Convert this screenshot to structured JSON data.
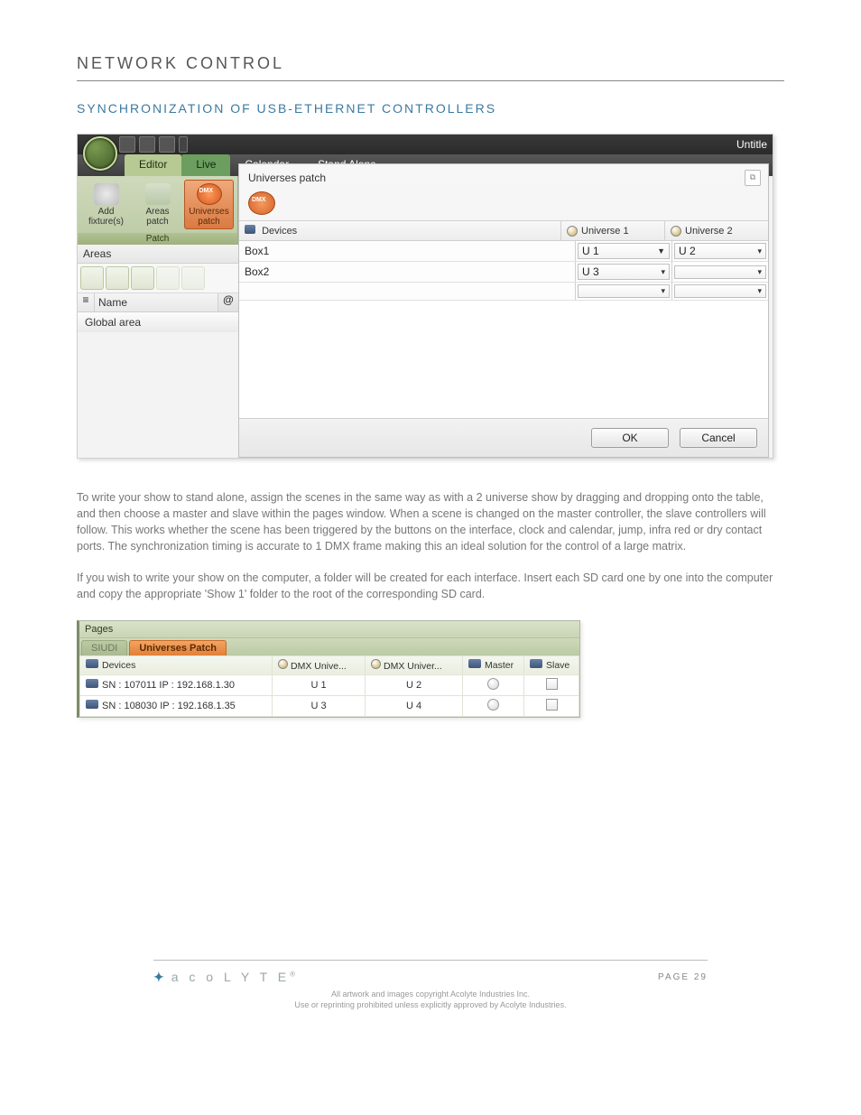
{
  "page": {
    "heading": "NETWORK CONTROL",
    "section_title": "SYNCHRONIZATION OF USB-ETHERNET CONTROLLERS"
  },
  "shot1": {
    "title_right": "Untitle",
    "tabs": {
      "editor": "Editor",
      "live": "Live",
      "calendar": "Calendar",
      "standalone": "Stand Alone"
    },
    "patch": {
      "add_fixtures": "Add\nfixture(s)",
      "areas_patch": "Areas\npatch",
      "universes_patch": "Universes\npatch",
      "group_label": "Patch"
    },
    "side": {
      "areas_hdr": "Areas",
      "name_label": "Name",
      "at_symbol": "@",
      "global_area": "Global area"
    },
    "dialog": {
      "title": "Universes patch",
      "cols": {
        "devices": "Devices",
        "u1": "Universe 1",
        "u2": "Universe 2"
      },
      "rows": [
        {
          "device": "Box1",
          "u1": "U 1",
          "u2": "U 2"
        },
        {
          "device": "Box2",
          "u1": "U 3",
          "u2": ""
        }
      ],
      "empty_row": {
        "u1": "",
        "u2": ""
      },
      "ok": "OK",
      "cancel": "Cancel"
    }
  },
  "para1": "To write your show to stand alone, assign the scenes in the same way as with a 2 universe show by dragging and dropping onto the table, and then choose a master and slave within the pages window.  When a scene is changed on the master controller, the slave controllers will follow. This works whether the scene has been triggered by the buttons on the interface, clock and calendar, jump, infra red or dry contact ports. The synchronization timing is accurate to 1 DMX frame making this an ideal solution for the control of a large matrix.",
  "para2": "If you wish to write your show on the computer, a folder will be created for each interface. Insert each SD card one by one into the computer and copy the appropriate 'Show 1' folder to the root of the corresponding SD card.",
  "shot2": {
    "pages_label": "Pages",
    "tabs": {
      "siudi": "SIUDI",
      "universes": "Universes Patch"
    },
    "cols": {
      "devices": "Devices",
      "dmx1": "DMX Unive...",
      "dmx2": "DMX Univer...",
      "master": "Master",
      "slave": "Slave"
    },
    "rows": [
      {
        "device": "SN : 107011   IP  : 192.168.1.30",
        "u1": "U 1",
        "u2": "U 2"
      },
      {
        "device": "SN : 108030   IP  : 192.168.1.35",
        "u1": "U 3",
        "u2": "U 4"
      }
    ]
  },
  "footer": {
    "brand": "a c o L Y T E",
    "page_no": "PAGE 29",
    "copy1": "All artwork and images copyright Acolyte Industries Inc.",
    "copy2": "Use or reprinting prohibited unless explicitly approved by Acolyte Industries."
  }
}
